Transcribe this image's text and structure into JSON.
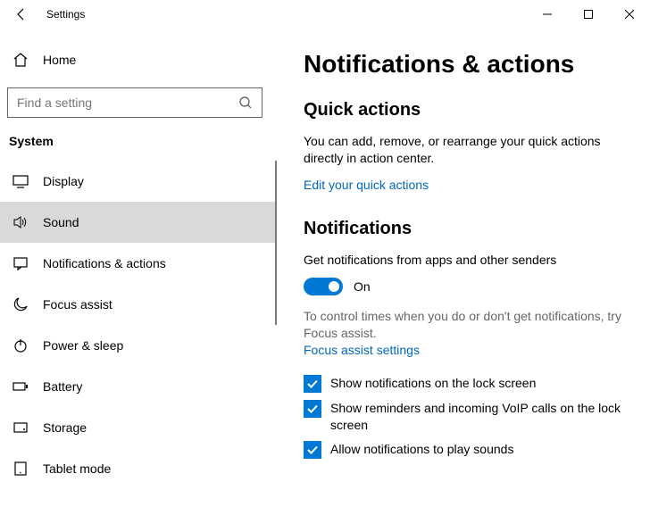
{
  "window": {
    "title": "Settings"
  },
  "sidebar": {
    "home": "Home",
    "search_placeholder": "Find a setting",
    "section": "System",
    "items": [
      {
        "label": "Display"
      },
      {
        "label": "Sound"
      },
      {
        "label": "Notifications & actions"
      },
      {
        "label": "Focus assist"
      },
      {
        "label": "Power & sleep"
      },
      {
        "label": "Battery"
      },
      {
        "label": "Storage"
      },
      {
        "label": "Tablet mode"
      }
    ]
  },
  "main": {
    "title": "Notifications & actions",
    "quick": {
      "heading": "Quick actions",
      "body": "You can add, remove, or rearrange your quick actions directly in action center.",
      "link": "Edit your quick actions"
    },
    "notifications": {
      "heading": "Notifications",
      "desc": "Get notifications from apps and other senders",
      "toggle_state": "On",
      "hint": "To control times when you do or don't get notifications, try Focus assist.",
      "focus_link": "Focus assist settings",
      "checks": [
        "Show notifications on the lock screen",
        "Show reminders and incoming VoIP calls on the lock screen",
        "Allow notifications to play sounds"
      ]
    }
  }
}
